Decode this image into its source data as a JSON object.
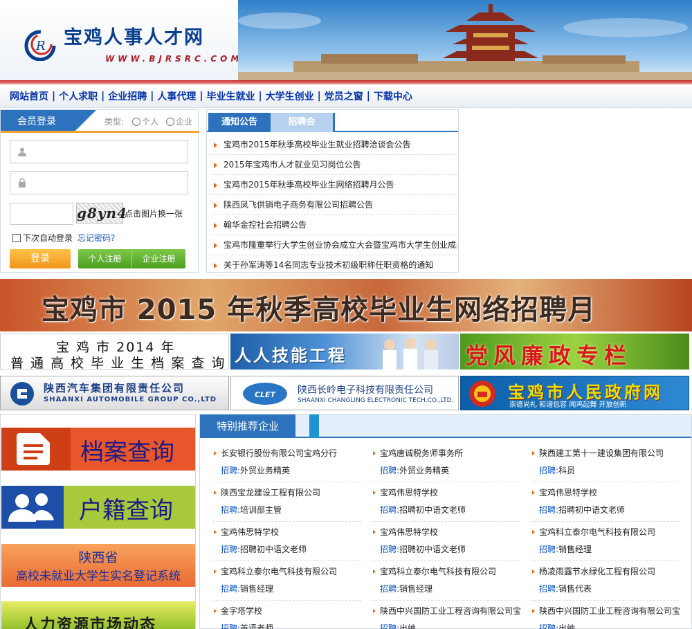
{
  "header": {
    "site_title": "宝鸡人事人才网",
    "site_url": "WWW.BJRSRC.COM",
    "logo_letters": "CR"
  },
  "nav": {
    "items": [
      "网站首页",
      "个人求职",
      "企业招聘",
      "人事代理",
      "毕业生就业",
      "大学生创业",
      "党员之窗",
      "下载中心"
    ],
    "separator": "|"
  },
  "login": {
    "tab_label": "会员登录",
    "type_label": "类型:",
    "option_personal": "个人",
    "option_company": "企业",
    "username_placeholder": "",
    "password_placeholder": "",
    "captcha_text": "g8yn4",
    "captcha_hint": "点击图片换一张",
    "autologin_label": "下次自动登录",
    "forgot_label": "忘记密码?",
    "login_button": "登录",
    "register_personal": "个人注册",
    "register_company": "企业注册"
  },
  "notice": {
    "tab_active": "通知公告",
    "tab_inactive": "招聘会",
    "items": [
      "宝鸡市2015年秋季高校毕业生就业招聘洽谈会公告",
      "2015年宝鸡市人才就业见习岗位公告",
      "宝鸡市2015年秋季高校毕业生网络招聘月公告",
      "陕西凤飞供销电子商务有限公司招聘公告",
      "翰华金控社会招聘公告",
      "宝鸡市隆重举行大学生创业协会成立大会暨宝鸡市大学生创业成果展",
      "关于孙军涛等14名同志专业技术初级职称任职资格的通知"
    ]
  },
  "banners": {
    "main": "宝鸡市 2015 年秋季高校毕业生网络招聘月",
    "archive_line1": "宝 鸡 市 2014 年",
    "archive_line2": "普 通 高 校 毕 业 生 档 案 查 询",
    "skills": "人人技能工程",
    "party": "党风廉政专栏",
    "shaanxi_auto_cn": "陕西汽车集团有限责任公司",
    "shaanxi_auto_en": "SHAANXI AUTOMOBILE GROUP CO.,LTD",
    "changling_cn": "陕西长岭电子科技有限责任公司",
    "changling_en": "SHAANXI CHANGLING ELECTRONIC TECH.CO.,LTD.",
    "changling_logo": "CLET",
    "gov_title": "宝鸡市人民政府网",
    "gov_slogan": "崇德尚礼 和谐包容 闻鸡起舞 开放创新"
  },
  "left_menu": {
    "archive": "档案查询",
    "household": "户籍查询",
    "reg_line1": "陕西省",
    "reg_line2": "高校未就业大学生实名登记系统",
    "market": "人力资源市场动态"
  },
  "recommend": {
    "title": "特别推荐企业",
    "job_prefix": "招聘:",
    "companies": [
      {
        "name": "长安银行股份有限公司宝鸡分行",
        "job": "外贸业务精英"
      },
      {
        "name": "宝鸡唐诚税务师事务所",
        "job": "外贸业务精英"
      },
      {
        "name": "陕西建工第十一建设集团有限公司",
        "job": "科员"
      },
      {
        "name": "陕西宝龙建设工程有限公司",
        "job": "培训部主管"
      },
      {
        "name": "宝鸡伟思特学校",
        "job": "招聘初中语文老师"
      },
      {
        "name": "宝鸡伟思特学校",
        "job": "招聘初中语文老师"
      },
      {
        "name": "宝鸡伟思特学校",
        "job": "招聘初中语文老师"
      },
      {
        "name": "宝鸡伟思特学校",
        "job": "招聘初中语文老师"
      },
      {
        "name": "宝鸡科立泰尔电气科技有限公司",
        "job": "销售经理"
      },
      {
        "name": "宝鸡科立泰尔电气科技有限公司",
        "job": "销售经理"
      },
      {
        "name": "宝鸡科立泰尔电气科技有限公司",
        "job": "销售经理"
      },
      {
        "name": "杨凌雨露节水绿化工程有限公司",
        "job": "销售代表"
      },
      {
        "name": "金字塔学校",
        "job": "英语老师"
      },
      {
        "name": "陕西中兴国防工业工程咨询有限公司宝鸡分公司",
        "job": "出纳"
      },
      {
        "name": "陕西中兴国防工业工程咨询有限公司宝鸡分公司",
        "job": "出纳"
      }
    ]
  }
}
